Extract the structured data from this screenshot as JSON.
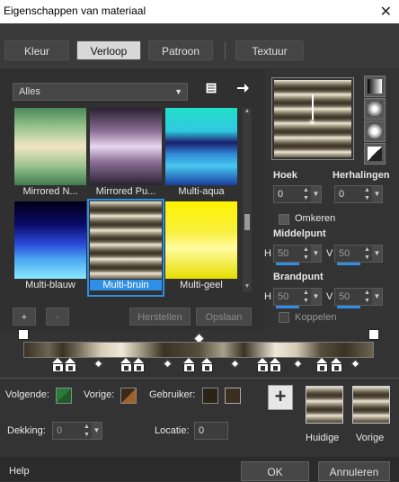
{
  "window": {
    "title": "Eigenschappen van materiaal",
    "close": "✕"
  },
  "tabs": [
    {
      "label": "Kleur",
      "active": false
    },
    {
      "label": "Verloop",
      "active": true
    },
    {
      "label": "Patroon",
      "active": false
    },
    {
      "label": "Textuur",
      "active": false
    }
  ],
  "category": {
    "value": "Alles"
  },
  "gradients": [
    {
      "label": "Mirrored N...",
      "selected": false
    },
    {
      "label": "Mirrored Pu...",
      "selected": false
    },
    {
      "label": "Multi-aqua",
      "selected": false
    },
    {
      "label": "Multi-blauw",
      "selected": false
    },
    {
      "label": "Multi-bruin",
      "selected": true
    },
    {
      "label": "Multi-geel",
      "selected": false
    }
  ],
  "list_buttons": {
    "add": "+",
    "remove": "-",
    "reset": "Herstellen",
    "save": "Opslaan"
  },
  "style": {
    "angle_label": "Hoek",
    "angle_value": "0",
    "repeats_label": "Herhalingen",
    "repeats_value": "0",
    "invert_label": "Omkeren",
    "center_label": "Middelpunt",
    "center_h": "50",
    "center_v": "50",
    "focal_label": "Brandpunt",
    "focal_h": "50",
    "focal_v": "50",
    "link_label": "Koppelen",
    "h_label": "H",
    "v_label": "V"
  },
  "editor": {
    "next_label": "Volgende:",
    "prev_label": "Vorige:",
    "user_label": "Gebruiker:",
    "opacity_label": "Dekking:",
    "opacity_value": "0",
    "location_label": "Locatie:",
    "location_value": "0",
    "current_label": "Huidige",
    "previous_label": "Vorige"
  },
  "footer": {
    "help": "Help",
    "ok": "OK",
    "cancel": "Annuleren"
  },
  "colors": {
    "accent": "#2f8fe6",
    "user_color": "#3b2f22"
  }
}
